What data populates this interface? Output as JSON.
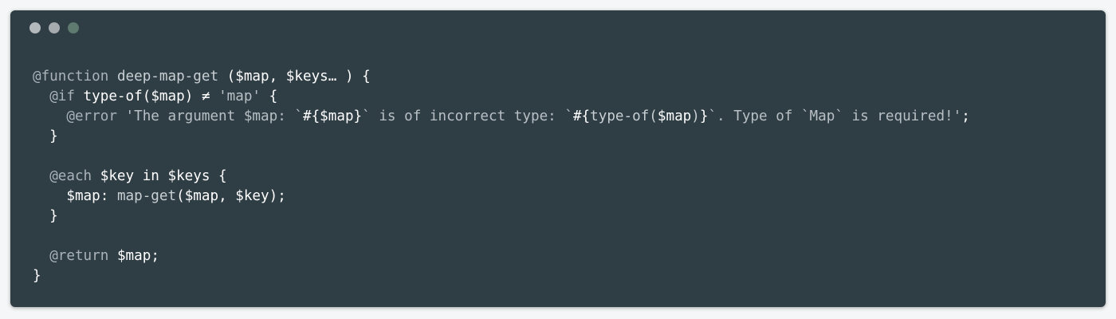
{
  "window": {
    "controls": [
      "close",
      "minimize",
      "zoom"
    ],
    "colors": {
      "background": "#2f3d45",
      "close": "#b3b8bb",
      "minimize": "#a6abaf",
      "zoom": "#5f7a6f"
    }
  },
  "code": {
    "language": "scss",
    "lines": [
      [
        {
          "t": "kw",
          "v": "@function"
        },
        {
          "t": "plain",
          "v": " "
        },
        {
          "t": "fn",
          "v": "deep-map-get"
        },
        {
          "t": "plain",
          "v": " ("
        },
        {
          "t": "var",
          "v": "$map"
        },
        {
          "t": "plain",
          "v": ", "
        },
        {
          "t": "var",
          "v": "$keys"
        },
        {
          "t": "plain",
          "v": "… ) {"
        }
      ],
      [
        {
          "t": "plain",
          "v": "  "
        },
        {
          "t": "kw",
          "v": "@if"
        },
        {
          "t": "plain",
          "v": " type-of("
        },
        {
          "t": "var",
          "v": "$map"
        },
        {
          "t": "plain",
          "v": ") ≠ "
        },
        {
          "t": "str",
          "v": "'map'"
        },
        {
          "t": "plain",
          "v": " {"
        }
      ],
      [
        {
          "t": "plain",
          "v": "    "
        },
        {
          "t": "kw",
          "v": "@error"
        },
        {
          "t": "plain",
          "v": " "
        },
        {
          "t": "str",
          "v": "'The argument $map: `"
        },
        {
          "t": "plain",
          "v": "#{"
        },
        {
          "t": "var",
          "v": "$map"
        },
        {
          "t": "plain",
          "v": "}"
        },
        {
          "t": "str",
          "v": "` is of incorrect type: `"
        },
        {
          "t": "plain",
          "v": "#{"
        },
        {
          "t": "fn",
          "v": "type-of("
        },
        {
          "t": "var",
          "v": "$map"
        },
        {
          "t": "fn",
          "v": ")"
        },
        {
          "t": "plain",
          "v": "}"
        },
        {
          "t": "str",
          "v": "`. Type of `Map` is required!'"
        },
        {
          "t": "plain",
          "v": ";"
        }
      ],
      [
        {
          "t": "plain",
          "v": "  }"
        }
      ],
      [
        {
          "t": "plain",
          "v": ""
        }
      ],
      [
        {
          "t": "plain",
          "v": "  "
        },
        {
          "t": "kw",
          "v": "@each"
        },
        {
          "t": "plain",
          "v": " "
        },
        {
          "t": "var",
          "v": "$key"
        },
        {
          "t": "plain",
          "v": " in "
        },
        {
          "t": "var",
          "v": "$keys"
        },
        {
          "t": "plain",
          "v": " {"
        }
      ],
      [
        {
          "t": "plain",
          "v": "    "
        },
        {
          "t": "var",
          "v": "$map"
        },
        {
          "t": "plain",
          "v": ": "
        },
        {
          "t": "fn",
          "v": "map-get"
        },
        {
          "t": "plain",
          "v": "("
        },
        {
          "t": "var",
          "v": "$map"
        },
        {
          "t": "plain",
          "v": ", "
        },
        {
          "t": "var",
          "v": "$key"
        },
        {
          "t": "plain",
          "v": ");"
        }
      ],
      [
        {
          "t": "plain",
          "v": "  }"
        }
      ],
      [
        {
          "t": "plain",
          "v": ""
        }
      ],
      [
        {
          "t": "plain",
          "v": "  "
        },
        {
          "t": "kw",
          "v": "@return"
        },
        {
          "t": "plain",
          "v": " "
        },
        {
          "t": "var",
          "v": "$map"
        },
        {
          "t": "plain",
          "v": ";"
        }
      ],
      [
        {
          "t": "plain",
          "v": "}"
        }
      ]
    ]
  }
}
